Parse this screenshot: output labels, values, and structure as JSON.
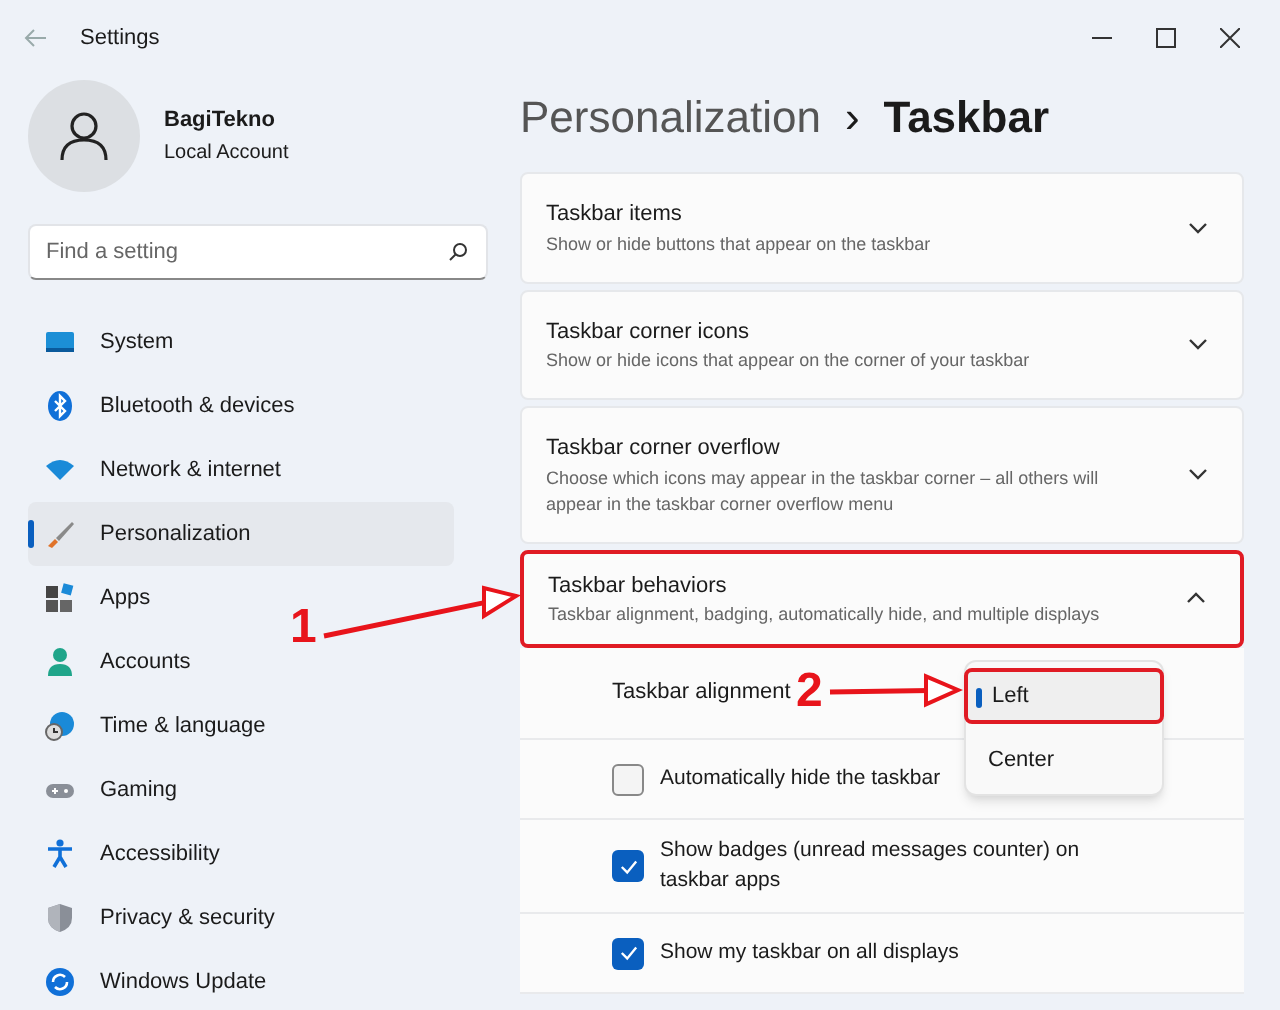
{
  "window": {
    "title": "Settings"
  },
  "account": {
    "name": "BagiTekno",
    "type": "Local Account"
  },
  "search": {
    "placeholder": "Find a setting"
  },
  "sidebar": {
    "items": [
      {
        "label": "System",
        "selected": false
      },
      {
        "label": "Bluetooth & devices",
        "selected": false
      },
      {
        "label": "Network & internet",
        "selected": false
      },
      {
        "label": "Personalization",
        "selected": true
      },
      {
        "label": "Apps",
        "selected": false
      },
      {
        "label": "Accounts",
        "selected": false
      },
      {
        "label": "Time & language",
        "selected": false
      },
      {
        "label": "Gaming",
        "selected": false
      },
      {
        "label": "Accessibility",
        "selected": false
      },
      {
        "label": "Privacy & security",
        "selected": false
      },
      {
        "label": "Windows Update",
        "selected": false
      }
    ]
  },
  "breadcrumb": {
    "parent": "Personalization",
    "separator": "›",
    "current": "Taskbar"
  },
  "cards": [
    {
      "title": "Taskbar items",
      "subtitle": "Show or hide buttons that appear on the taskbar",
      "expanded": false,
      "highlighted": false
    },
    {
      "title": "Taskbar corner icons",
      "subtitle": "Show or hide icons that appear on the corner of your taskbar",
      "expanded": false,
      "highlighted": false
    },
    {
      "title": "Taskbar corner overflow",
      "subtitle": "Choose which icons may appear in the taskbar corner – all others will appear in the taskbar corner overflow menu",
      "expanded": false,
      "highlighted": false
    },
    {
      "title": "Taskbar behaviors",
      "subtitle": "Taskbar alignment, badging, automatically hide, and multiple displays",
      "expanded": true,
      "highlighted": true
    }
  ],
  "behaviors": [
    {
      "kind": "select",
      "label": "Taskbar alignment"
    },
    {
      "kind": "checkbox",
      "label": "Automatically hide the taskbar",
      "checked": false
    },
    {
      "kind": "checkbox",
      "label": "Show badges (unread messages counter) on taskbar apps",
      "checked": true
    },
    {
      "kind": "checkbox",
      "label": "Show my taskbar on all displays",
      "checked": true
    }
  ],
  "alignment_menu": {
    "options": [
      {
        "label": "Left",
        "selected": true,
        "highlighted": true
      },
      {
        "label": "Center",
        "selected": false,
        "highlighted": false
      }
    ]
  },
  "annotations": [
    {
      "label": "1"
    },
    {
      "label": "2"
    }
  ]
}
